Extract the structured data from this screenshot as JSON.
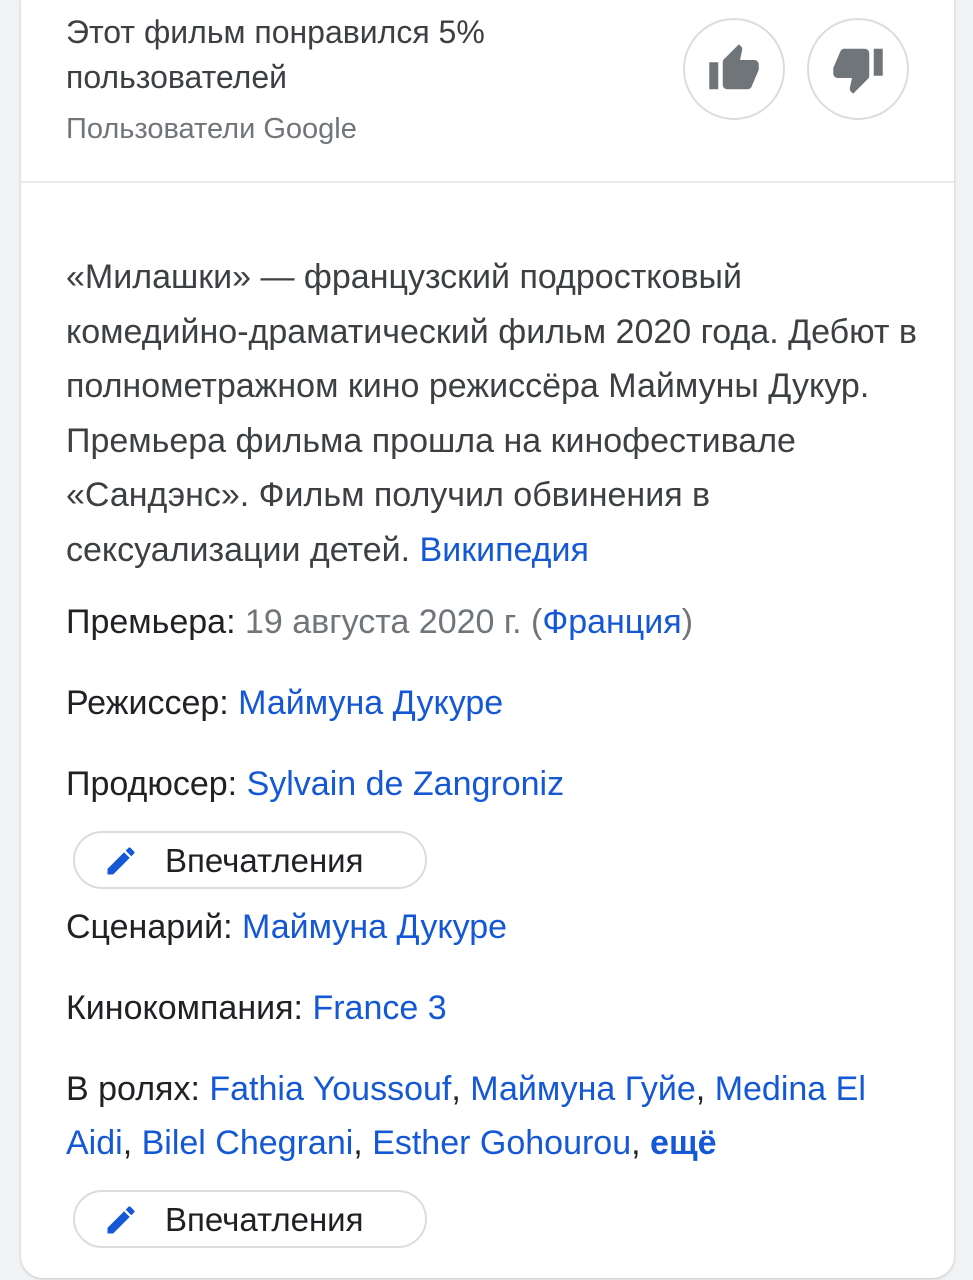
{
  "rating": {
    "text": "Этот фильм понравился 5% пользователей",
    "source": "Пользователи Google"
  },
  "description": {
    "text": "«Милашки» — французский подростковый комедийно-драматический фильм 2020 года. Дебют в полнометражном кино режиссёра Маймуны Дукур. Премьера фильма прошла на кинофестивале «Сандэнс». Фильм получил обвинения в сексуализации детей.",
    "source_link": "Википедия"
  },
  "facts": {
    "premiere": {
      "label": "Премьера:",
      "date": "19 августа 2020 г.",
      "open_paren": "(",
      "country": "Франция",
      "close_paren": ")"
    },
    "director": {
      "label": "Режиссер:",
      "value": "Маймуна Дукуре"
    },
    "producer": {
      "label": "Продюсер:",
      "value": "Sylvain de Zangroniz"
    },
    "screenplay": {
      "label": "Сценарий:",
      "value": "Маймуна Дукуре"
    },
    "company": {
      "label": "Кинокомпания:",
      "value": "France 3"
    },
    "cast": {
      "label": "В ролях:",
      "actors": [
        "Fathia Youssouf",
        "Маймуна Гуйе",
        "Medina El Aidi",
        "Bilel Chegrani",
        "Esther Gohourou"
      ],
      "separator": ",",
      "more": "ещё"
    }
  },
  "chips": {
    "impressions_label": "Впечатления"
  },
  "icons": {
    "thumbs_up": "thumbs-up-icon",
    "thumbs_down": "thumbs-down-icon",
    "pencil": "pencil-icon"
  },
  "colors": {
    "link": "#1558d6",
    "icon_gray": "#70757a",
    "text": "#202124"
  }
}
